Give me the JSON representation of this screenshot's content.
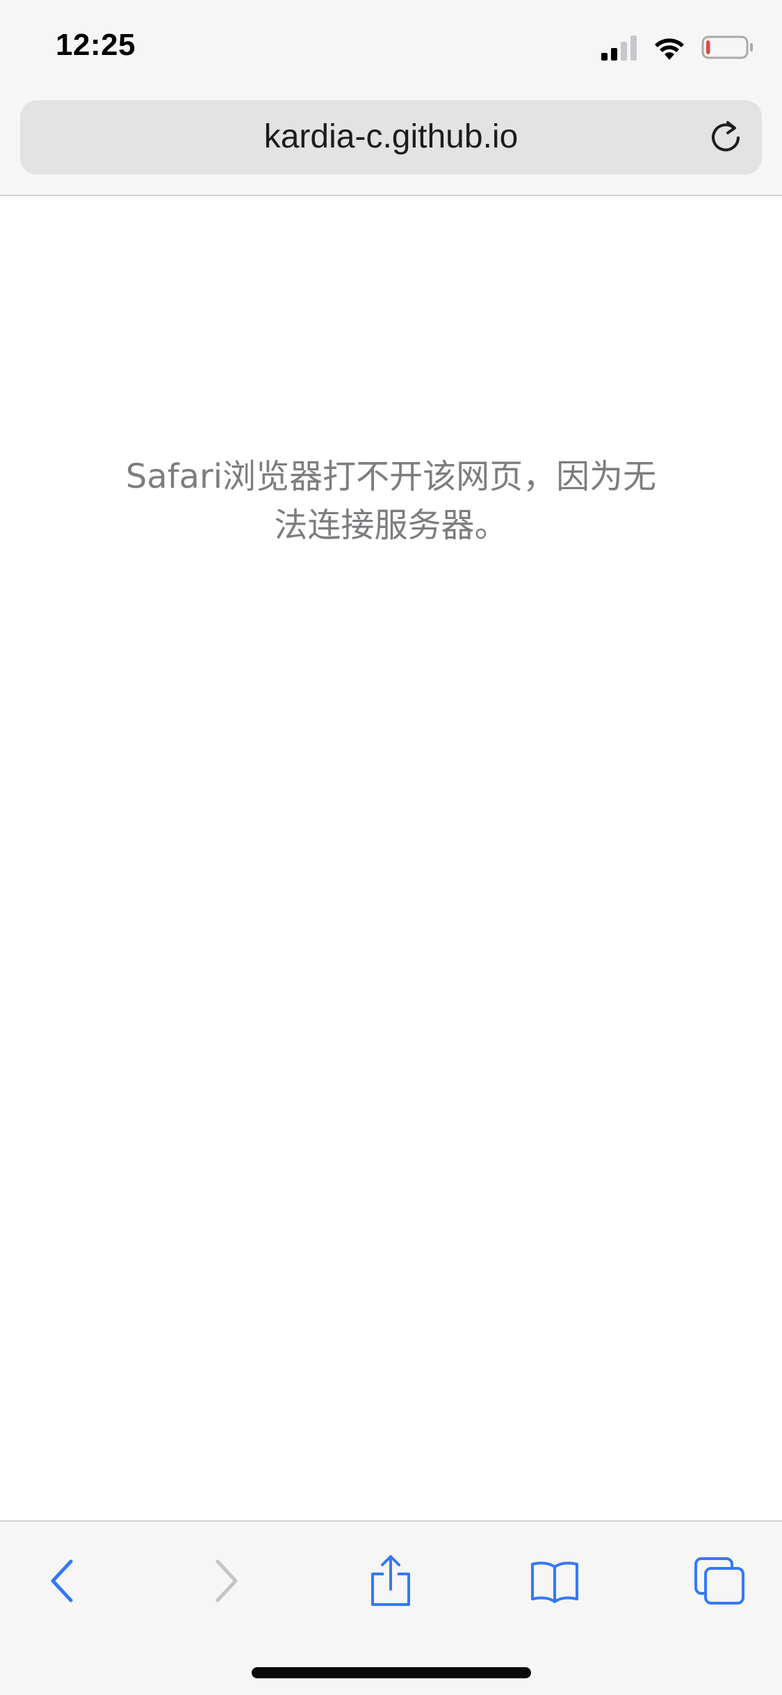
{
  "status_bar": {
    "time": "12:25",
    "icons": [
      "signal-icon",
      "wifi-icon",
      "battery-icon"
    ],
    "battery_level": 0.1,
    "battery_color": "#e0483e"
  },
  "url_bar": {
    "url": "kardia-c.github.io",
    "reload_icon": "reload-icon"
  },
  "content": {
    "error_line_1": "Safari浏览器打不开该网页，因为无",
    "error_line_2": "法连接服务器。"
  },
  "toolbar": {
    "buttons": [
      {
        "icon": "back-icon",
        "enabled": true
      },
      {
        "icon": "forward-icon",
        "enabled": false
      },
      {
        "icon": "share-icon",
        "enabled": true
      },
      {
        "icon": "bookmarks-icon",
        "enabled": true
      },
      {
        "icon": "tabs-icon",
        "enabled": true
      }
    ],
    "accent_color": "#3478f6",
    "disabled_color": "#c4c4c7"
  }
}
